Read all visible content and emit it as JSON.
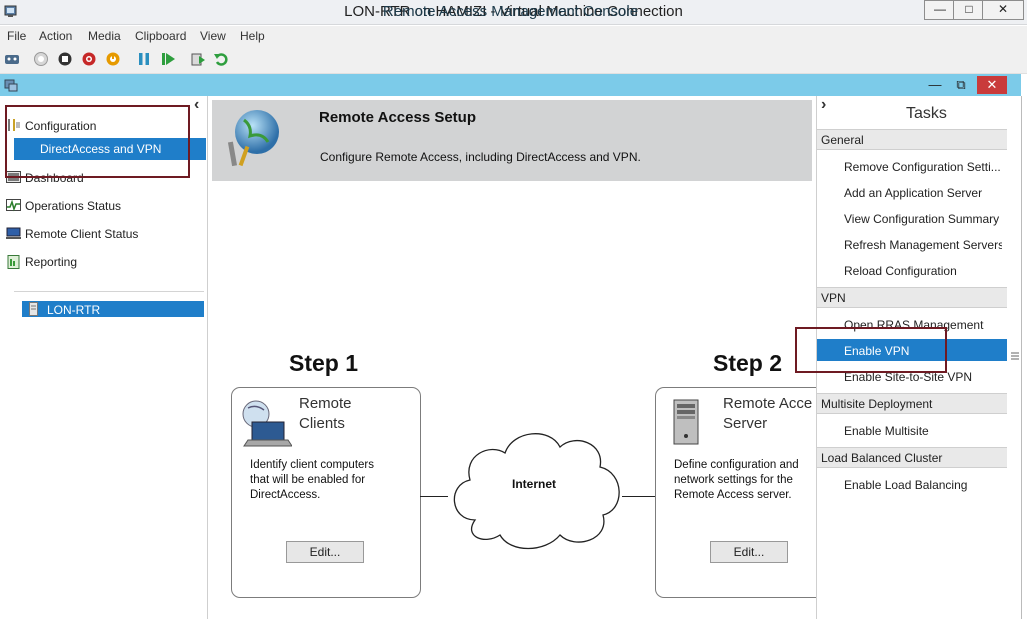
{
  "vm": {
    "title": "LON-RTR on HAMIZI - Virtual Machine Connection",
    "menu": [
      "File",
      "Action",
      "Media",
      "Clipboard",
      "View",
      "Help"
    ],
    "window_buttons": [
      "—",
      "□",
      "✕"
    ]
  },
  "console": {
    "title": "Remote Access Management Console",
    "window_buttons": [
      "—",
      "⧉",
      "✕"
    ]
  },
  "nav": {
    "configuration": "Configuration",
    "selected": "DirectAccess and VPN",
    "dashboard": "Dashboard",
    "operations_status": "Operations Status",
    "remote_client_status": "Remote Client Status",
    "reporting": "Reporting",
    "server": "LON-RTR",
    "collapse_glyph": "‹"
  },
  "banner": {
    "title": "Remote Access Setup",
    "description": "Configure Remote Access, including DirectAccess and VPN."
  },
  "steps": {
    "step1": {
      "heading": "Step 1",
      "title_line1": "Remote",
      "title_line2": "Clients",
      "desc_line1": "Identify client computers",
      "desc_line2": "that will be enabled for",
      "desc_line3": "DirectAccess.",
      "button": "Edit..."
    },
    "internet": "Internet",
    "step2": {
      "heading": "Step 2",
      "title_line1": "Remote Acce",
      "title_line2": "Server",
      "desc_line1": "Define configuration and",
      "desc_line2": "network settings for the",
      "desc_line3": "Remote Access server.",
      "button": "Edit..."
    }
  },
  "tasks": {
    "title": "Tasks",
    "expand_glyph": "›",
    "general": {
      "header": "General",
      "items": [
        "Remove Configuration Setti...",
        "Add an Application Server",
        "View Configuration Summary",
        "Refresh Management Servers",
        "Reload Configuration"
      ]
    },
    "vpn": {
      "header": "VPN",
      "items": [
        "Open RRAS Management",
        "Enable VPN",
        "Enable Site-to-Site VPN"
      ]
    },
    "multisite": {
      "header": "Multisite Deployment",
      "items": [
        "Enable Multisite"
      ]
    },
    "lb": {
      "header": "Load Balanced Cluster",
      "items": [
        "Enable Load Balancing"
      ]
    }
  },
  "colors": {
    "console_title": "#7ccbe9",
    "selection": "#1f7ec9",
    "highlight_box": "#6e1a22",
    "banner": "#d2d3d4"
  }
}
